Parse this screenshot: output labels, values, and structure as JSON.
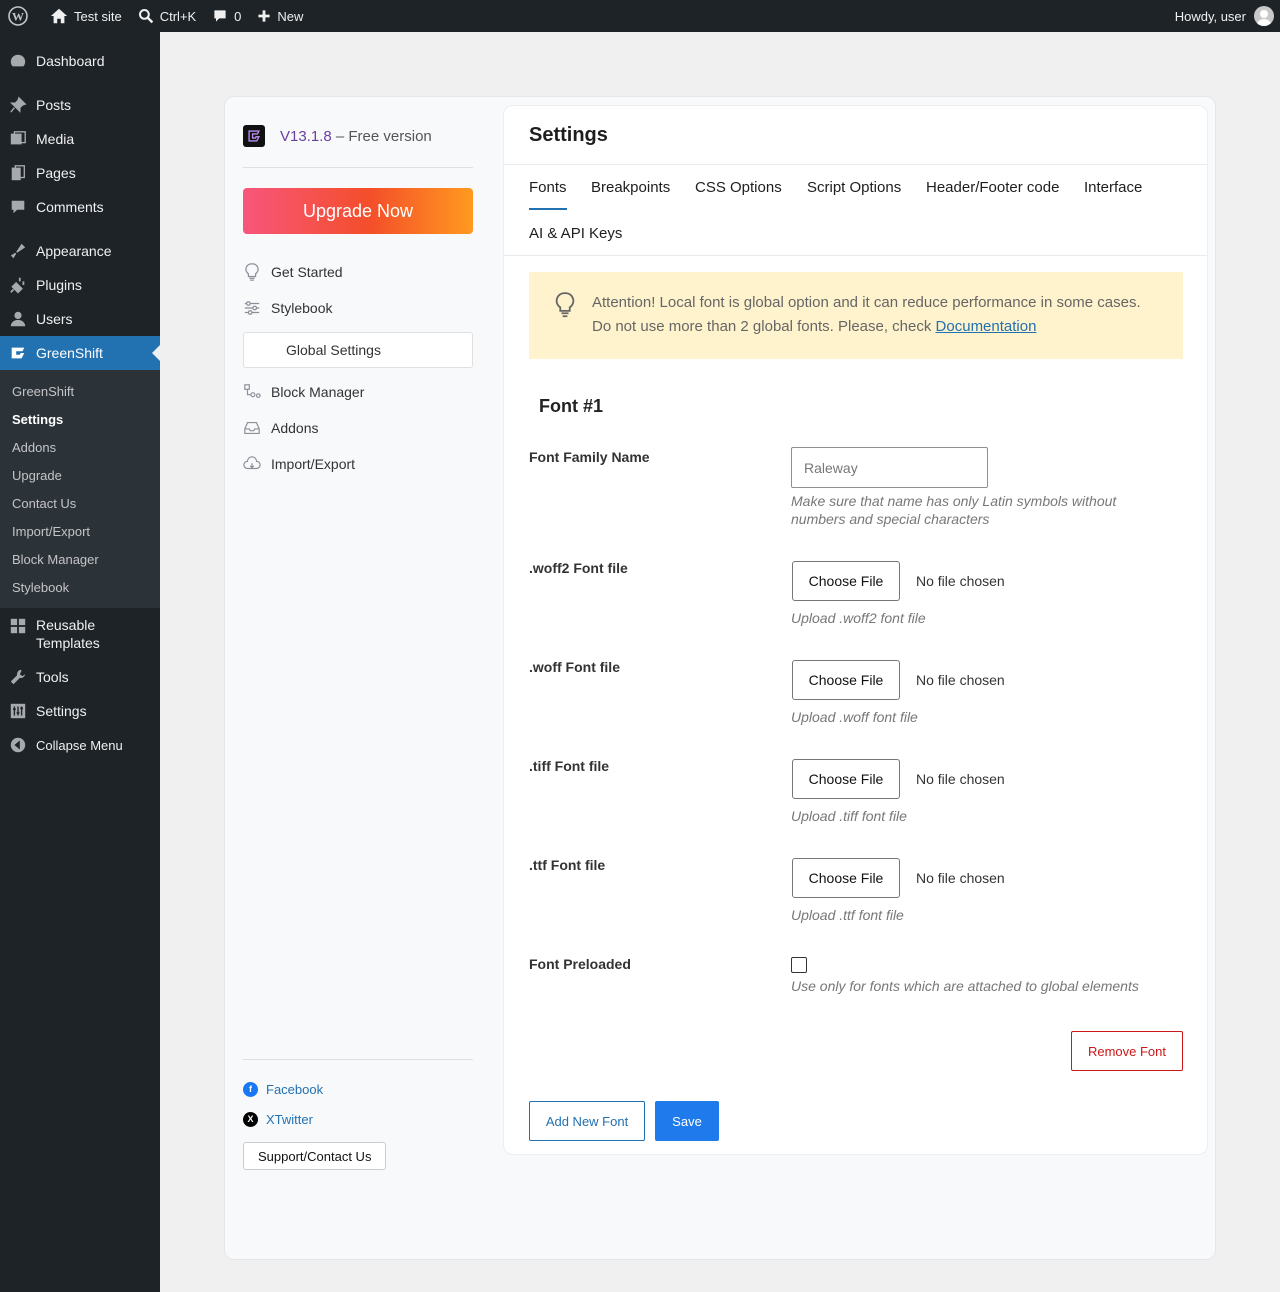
{
  "admin_bar": {
    "site_name": "Test site",
    "search_shortcut": "Ctrl+K",
    "comments_count": "0",
    "new_label": "New",
    "greeting": "Howdy, user"
  },
  "menu": {
    "dashboard": "Dashboard",
    "posts": "Posts",
    "media": "Media",
    "pages": "Pages",
    "comments": "Comments",
    "appearance": "Appearance",
    "plugins": "Plugins",
    "users": "Users",
    "greenshift": "GreenShift",
    "submenu": [
      "GreenShift",
      "Settings",
      "Addons",
      "Upgrade",
      "Contact Us",
      "Import/Export",
      "Block Manager",
      "Stylebook"
    ],
    "reusable_templates": "Reusable Templates",
    "tools": "Tools",
    "settings": "Settings",
    "collapse": "Collapse Menu"
  },
  "gs_sidebar": {
    "version": "V13.1.8",
    "version_suffix": " – Free version",
    "upgrade_label": "Upgrade Now",
    "nav": {
      "get_started": "Get Started",
      "stylebook": "Stylebook",
      "global_settings": "Global Settings",
      "block_manager": "Block Manager",
      "addons": "Addons",
      "import_export": "Import/Export"
    },
    "facebook": "Facebook",
    "twitter": "XTwitter",
    "support": "Support/Contact Us"
  },
  "settings": {
    "title": "Settings",
    "tabs": [
      "Fonts",
      "Breakpoints",
      "CSS Options",
      "Script Options",
      "Header/Footer code",
      "Interface",
      "AI & API Keys"
    ],
    "notice_text": "Attention! Local font is global option and it can reduce performance in some cases. Do not use more than 2 global fonts. Please, check ",
    "notice_link": "Documentation",
    "font_heading": "Font #1",
    "family_label": "Font Family Name",
    "family_placeholder": "Raleway",
    "family_hint": "Make sure that name has only Latin symbols without numbers and special characters",
    "choose_file": "Choose File",
    "no_file": "No file chosen",
    "woff2_label": ".woff2 Font file",
    "woff2_hint": "Upload .woff2 font file",
    "woff_label": ".woff Font file",
    "woff_hint": "Upload .woff font file",
    "tiff_label": ".tiff Font file",
    "tiff_hint": "Upload .tiff font file",
    "ttf_label": ".ttf Font file",
    "ttf_hint": "Upload .ttf font file",
    "preload_label": "Font Preloaded",
    "preload_hint": "Use only for fonts which are attached to global elements",
    "remove_font": "Remove Font",
    "add_new_font": "Add New Font",
    "save": "Save"
  },
  "colors": {
    "accent": "#2271b1",
    "admin_dark": "#1d2327",
    "danger": "#cc1818",
    "notice_bg": "#fff3cd"
  }
}
